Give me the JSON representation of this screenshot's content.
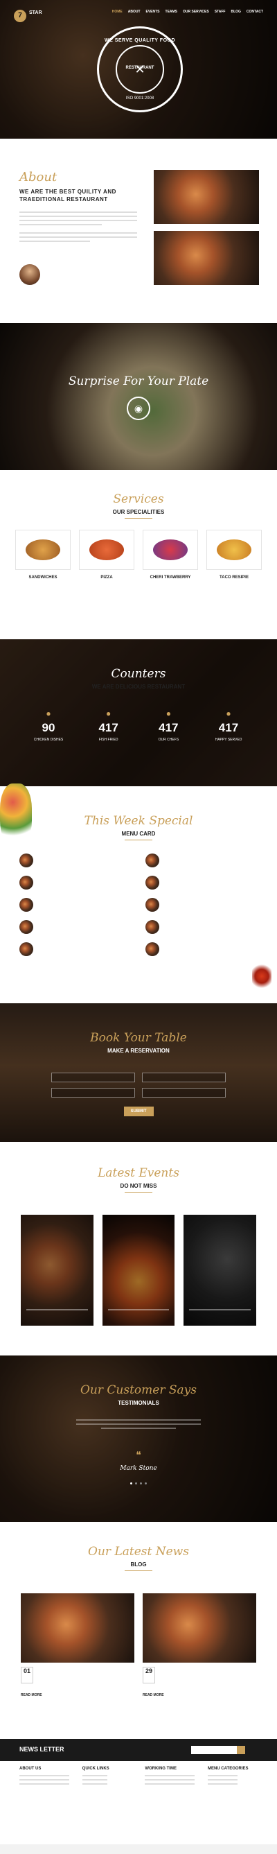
{
  "header": {
    "logo_number": "7",
    "logo_name": "STAR",
    "nav": [
      "HOME",
      "ABOUT",
      "EVENTS",
      "TEAMS",
      "OUR SERVICES",
      "STAFF",
      "BLOG",
      "CONTACT"
    ],
    "emblem_top": "WE SERVE QUALITY FOOD",
    "emblem_center": "RESTAURANT",
    "emblem_year": "ISO 9001:2008"
  },
  "about": {
    "title": "About",
    "heading": "WE ARE THE BEST QUILITY AND TRAEDITIONAL RESTAURANT",
    "author": ""
  },
  "surprise": {
    "title": "Surprise For Your Plate"
  },
  "services": {
    "title": "Services",
    "subtitle": "OUR SPECIALITIES",
    "items": [
      "SANDWICHES",
      "PIZZA",
      "CHERI TRAWBERRY",
      "TACO RESIPIE"
    ]
  },
  "counters": {
    "title": "Counters",
    "subtitle": "WE ARE DELICIOUS RESTAURANT",
    "items": [
      {
        "value": "90",
        "label": "CHICKEN DISHES"
      },
      {
        "value": "417",
        "label": "FISH FRIED"
      },
      {
        "value": "417",
        "label": "OUR CHEFS"
      },
      {
        "value": "417",
        "label": "HAPPY SERVED"
      }
    ]
  },
  "weekly": {
    "title": "This Week Special",
    "subtitle": "MENU CARD"
  },
  "book": {
    "title": "Book Your Table",
    "subtitle": "MAKE A RESERVATION",
    "fields": [
      "",
      "",
      "",
      ""
    ],
    "submit": "SUBMIT"
  },
  "events": {
    "title": "Latest Events",
    "subtitle": "DO NOT MISS",
    "items": [
      "",
      "",
      ""
    ]
  },
  "testimonials": {
    "title": "Our Customer Says",
    "subtitle": "TESTIMONIALS",
    "author": "Mark Stone"
  },
  "news": {
    "title": "Our Latest News",
    "subtitle": "BLOG",
    "items": [
      {
        "day": "01",
        "heading": "",
        "more": "READ MORE"
      },
      {
        "day": "29",
        "heading": "",
        "more": "READ MORE"
      }
    ]
  },
  "newsletter": {
    "title": "NEWS LETTER",
    "placeholder": "",
    "button": ""
  },
  "footer": {
    "cols": [
      {
        "title": "ABOUT US",
        "links": []
      },
      {
        "title": "QUICK LINKS",
        "links": []
      },
      {
        "title": "WORKING TIME",
        "links": []
      },
      {
        "title": "MENU CATEGORIES",
        "links": []
      }
    ],
    "copyright": ""
  }
}
